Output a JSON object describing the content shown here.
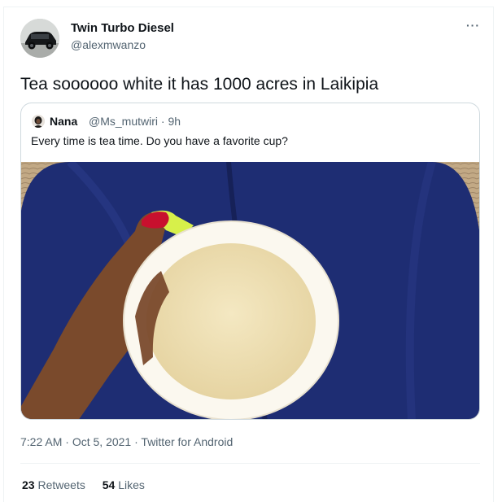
{
  "author": {
    "name": "Twin Turbo Diesel",
    "handle": "@alexmwanzo",
    "avatar": "car-avatar"
  },
  "tweet": {
    "text": "Tea soooooo white it has 1000 acres in Laikipia",
    "more_icon": "more-options-icon",
    "more_label": "···"
  },
  "quoted": {
    "name": "Nana",
    "handle": "@Ms_mutwiri",
    "sep": "·",
    "age": "9h",
    "text": "Every time is tea time. Do you have a favorite cup?",
    "image": "hand-holding-cup-of-milky-tea-photo"
  },
  "meta": {
    "time": "7:22 AM",
    "date": "Oct 5, 2021",
    "sep": "·",
    "source": "Twitter for Android"
  },
  "stats": {
    "retweets_count": "23",
    "retweets_label": "Retweets",
    "likes_count": "54",
    "likes_label": "Likes"
  },
  "colors": {
    "text": "#0f1419",
    "secondary": "#536471",
    "border": "#cfd9de",
    "jeans": "#1f2f78",
    "tea": "#efe2b6"
  }
}
